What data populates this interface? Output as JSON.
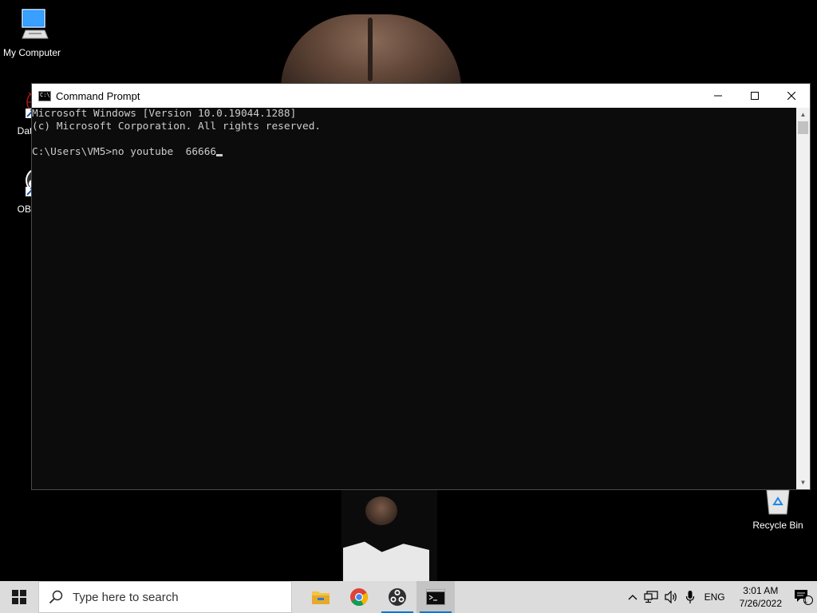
{
  "desktop": {
    "icons": [
      {
        "label": "My Computer",
        "icon": "computer-icon"
      },
      {
        "label": "DataW",
        "icon": "datawrangler-icon"
      },
      {
        "label": "OBS S",
        "icon": "obs-icon"
      },
      {
        "label": "Recycle Bin",
        "icon": "recycle-bin-icon"
      }
    ]
  },
  "window": {
    "title": "Command Prompt",
    "console_lines": [
      "Microsoft Windows [Version 10.0.19044.1288]",
      "(c) Microsoft Corporation. All rights reserved.",
      "",
      "C:\\Users\\VM5>no youtube  66666"
    ]
  },
  "taskbar": {
    "search_placeholder": "Type here to search",
    "apps": [
      {
        "name": "file-explorer",
        "icon": "folder-icon"
      },
      {
        "name": "chrome",
        "icon": "chrome-icon"
      },
      {
        "name": "obs-studio",
        "icon": "obs-icon",
        "running": true
      },
      {
        "name": "command-prompt",
        "icon": "cmd-icon",
        "running": true,
        "active": true
      }
    ],
    "tray": {
      "language": "ENG",
      "time": "3:01 AM",
      "date": "7/26/2022",
      "notification_count": "1"
    }
  },
  "colors": {
    "console_bg": "#0c0c0c",
    "console_text": "#cccccc",
    "taskbar_bg": "#dcdcdc",
    "accent": "#0078d7"
  }
}
